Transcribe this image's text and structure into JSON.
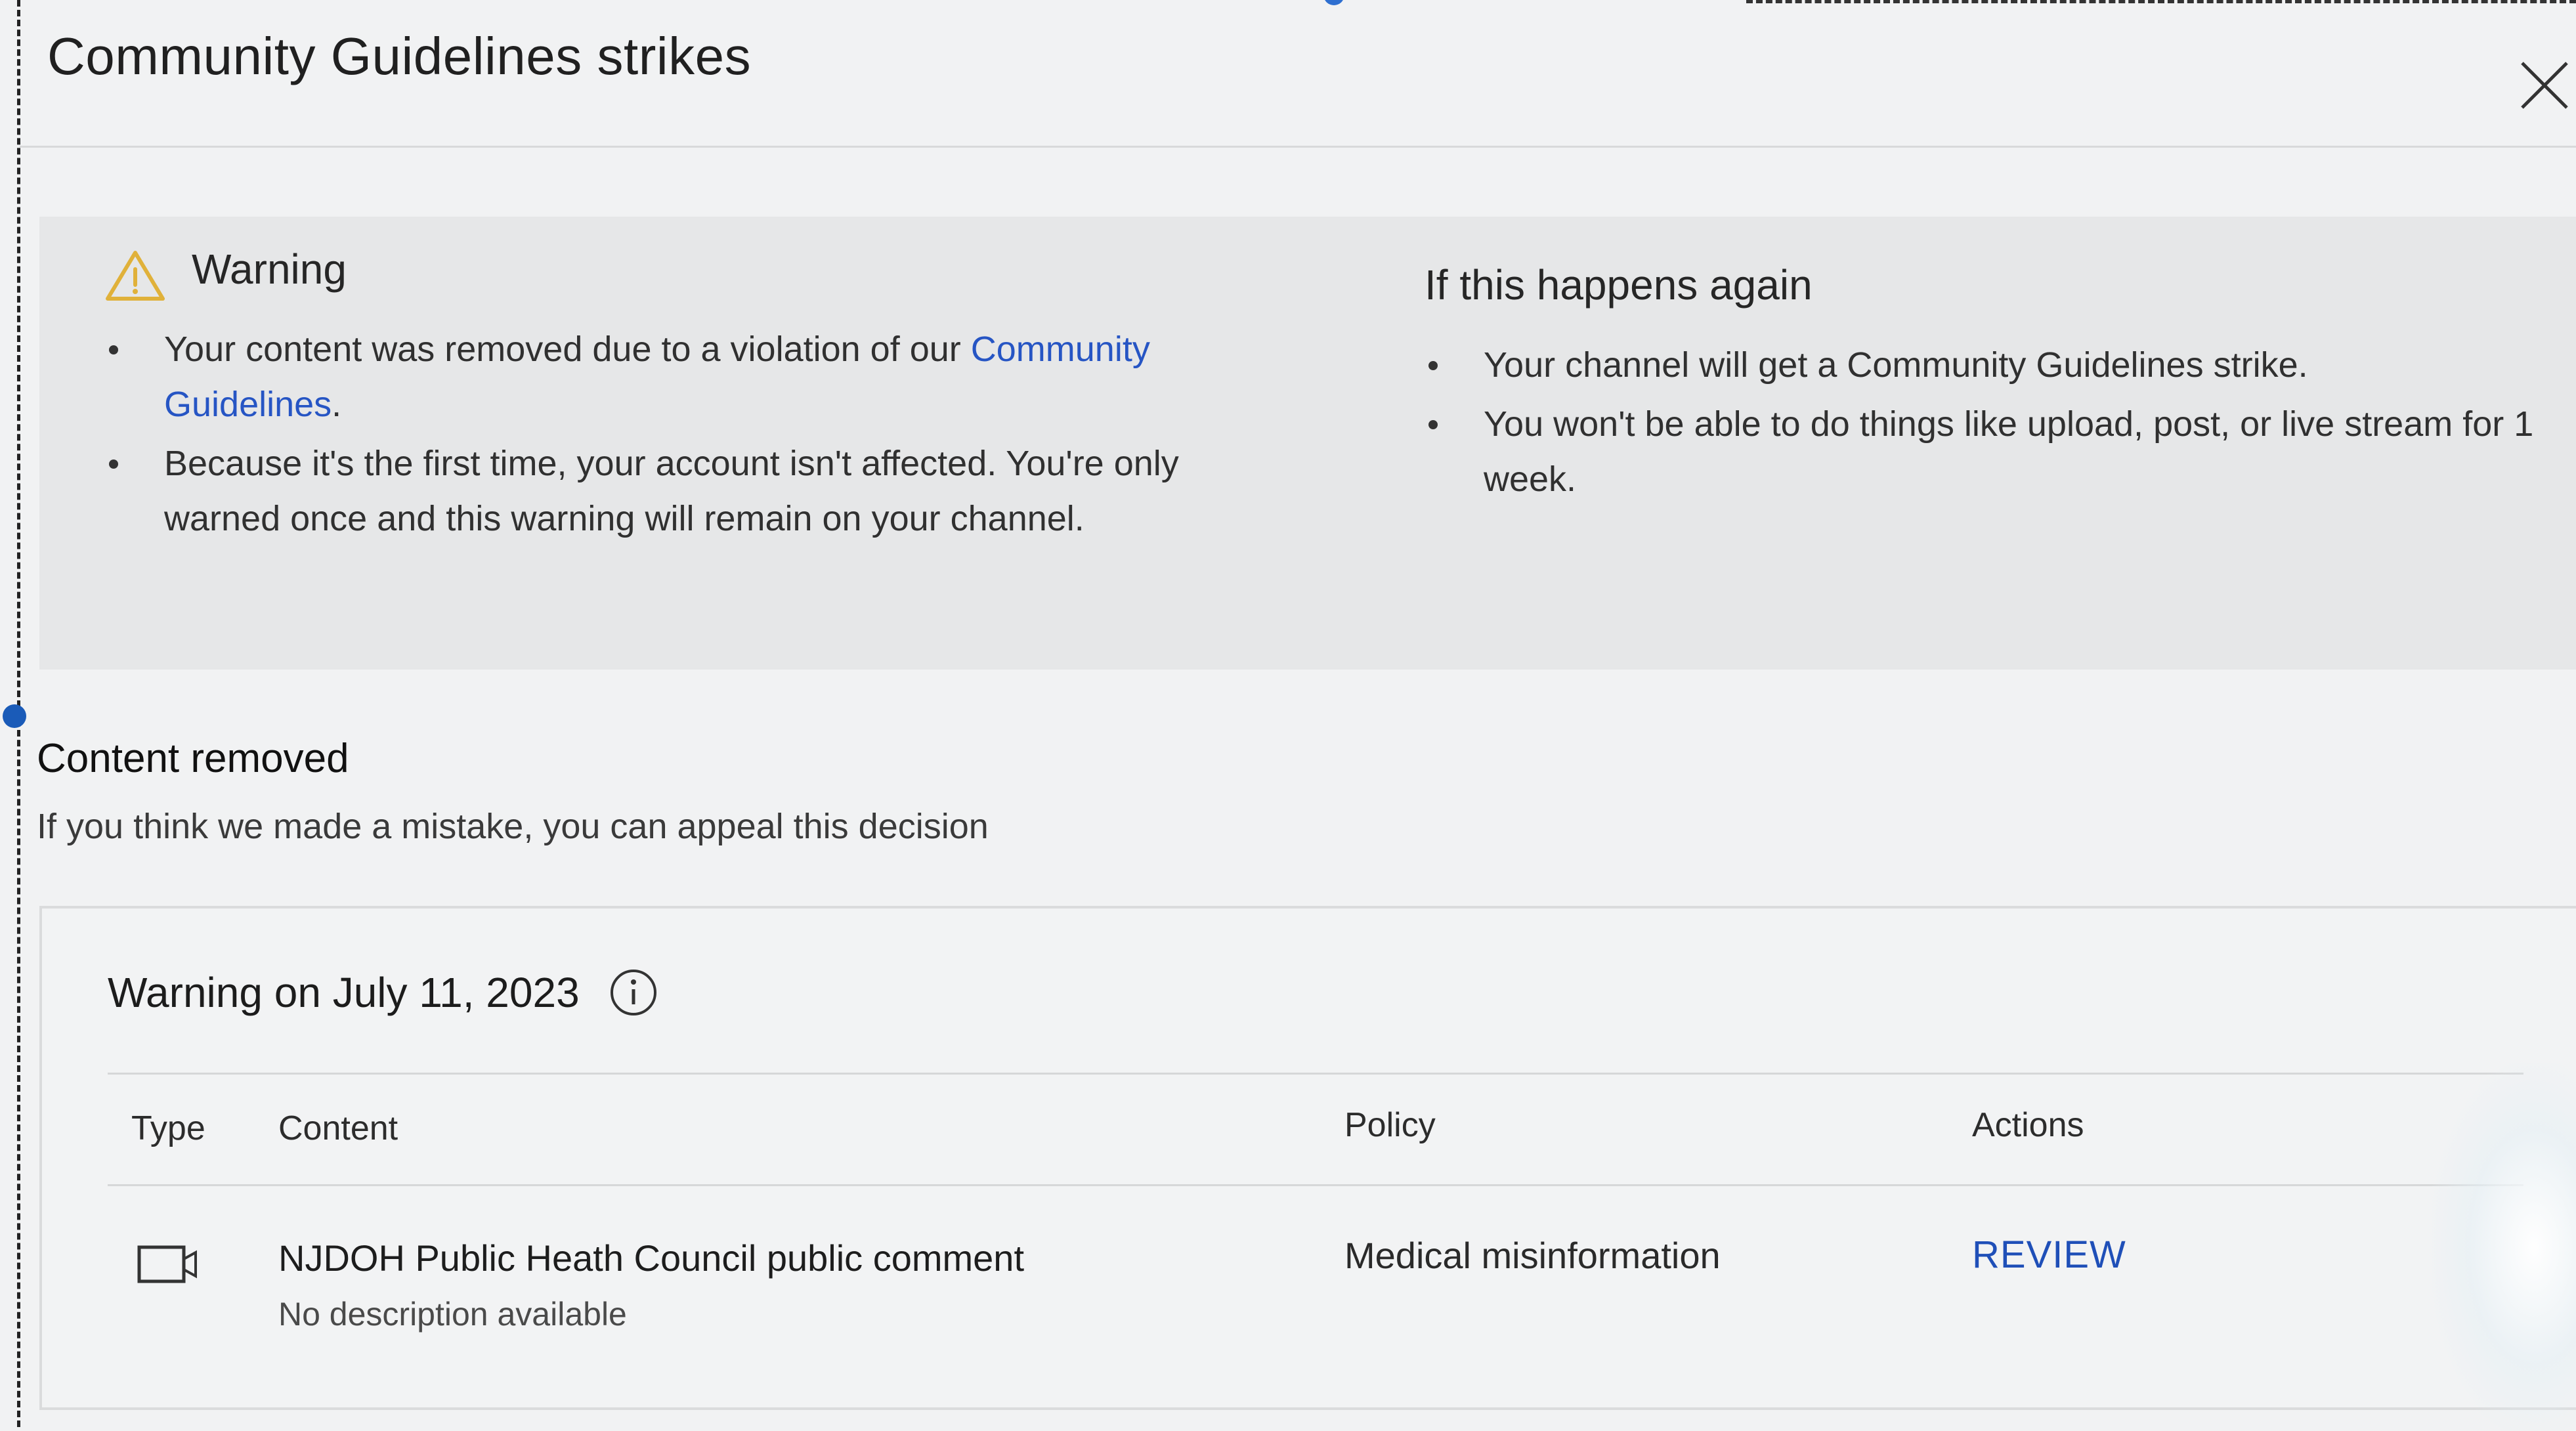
{
  "dialog": {
    "title": "Community Guidelines strikes",
    "close_icon": "close-icon"
  },
  "warning_panel": {
    "icon": "warning-triangle-icon",
    "heading": "Warning",
    "bullet1_text": "Your content was removed due to a violation of our ",
    "bullet1_link": "Community Guidelines",
    "bullet1_end": ".",
    "bullet2_text": "Because it's the first time, your account isn't affected. You're only warned once and this warning will remain on your channel."
  },
  "again_panel": {
    "heading": "If this happens again",
    "bullets": [
      "Your channel will get a Community Guidelines strike.",
      "You won't be able to do things like upload, post, or live stream for 1 week."
    ]
  },
  "content_removed": {
    "title": "Content removed",
    "subtitle": "If you think we made a mistake, you can appeal this decision"
  },
  "card": {
    "title": "Warning on July 11, 2023",
    "info_icon": "info-icon",
    "columns": [
      "Type",
      "Content",
      "Policy",
      "Actions"
    ],
    "row": {
      "type_icon": "video-icon",
      "content_title": "NJDOH Public Heath Council public comment",
      "content_description": "No description available",
      "policy": "Medical misinformation",
      "action": "REVIEW"
    }
  },
  "colors": {
    "link": "#2655c4",
    "review": "#1f4fb8",
    "panel_bg": "#e6e7e8",
    "warning_icon": "#e0b13a"
  }
}
